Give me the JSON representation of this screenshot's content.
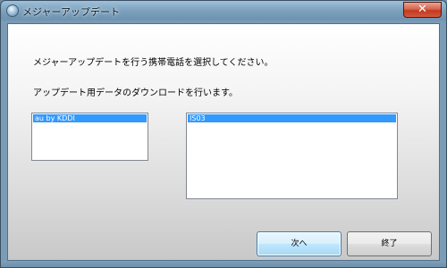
{
  "window": {
    "title": "メジャーアップデート",
    "close_label": "✕"
  },
  "content": {
    "message_select": "メジャーアップデートを行う携帯電話を選択してください。",
    "message_download": "アップデート用データのダウンロードを行います。",
    "carrier_list": {
      "selected": "au by KDDI"
    },
    "model_list": {
      "selected": "IS03"
    }
  },
  "buttons": {
    "next": "次へ",
    "end": "終了"
  },
  "colors": {
    "selection": "#3399ff",
    "close_button": "#c2391f"
  }
}
